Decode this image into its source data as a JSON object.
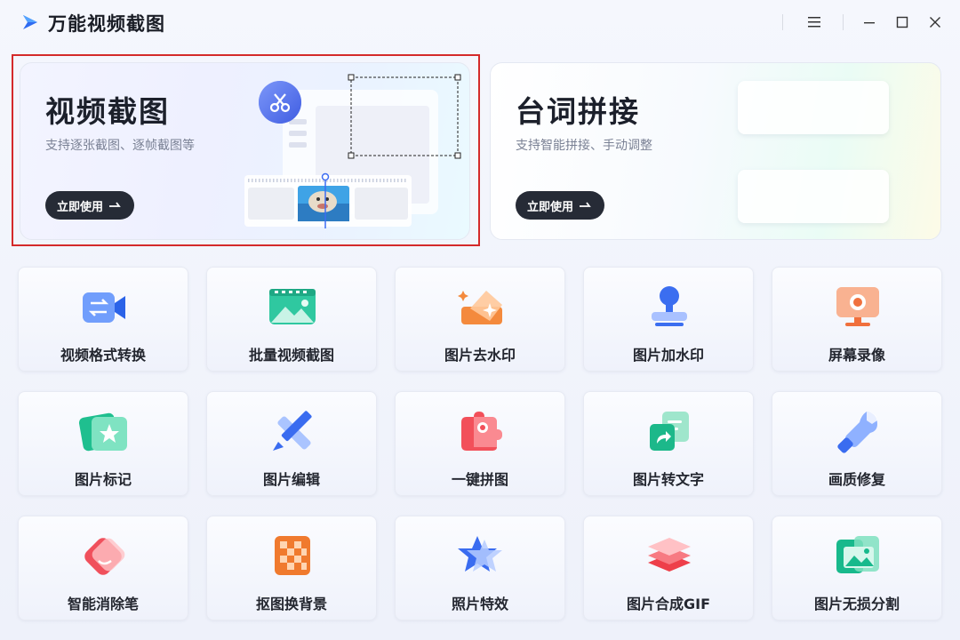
{
  "app": {
    "title": "万能视频截图"
  },
  "window_controls": [
    "menu-icon",
    "minimize-icon",
    "maximize-icon",
    "close-icon"
  ],
  "features": [
    {
      "title": "视频截图",
      "desc": "支持逐张截图、逐帧截图等",
      "button": "立即使用"
    },
    {
      "title": "台词拼接",
      "desc": "支持智能拼接、手动调整",
      "button": "立即使用"
    }
  ],
  "tools": [
    {
      "label": "视频格式转换",
      "icon": "video-convert-icon"
    },
    {
      "label": "批量视频截图",
      "icon": "batch-screenshot-icon"
    },
    {
      "label": "图片去水印",
      "icon": "remove-watermark-icon"
    },
    {
      "label": "图片加水印",
      "icon": "add-watermark-icon"
    },
    {
      "label": "屏幕录像",
      "icon": "screen-record-icon"
    },
    {
      "label": "图片标记",
      "icon": "image-mark-icon"
    },
    {
      "label": "图片编辑",
      "icon": "image-edit-icon"
    },
    {
      "label": "一键拼图",
      "icon": "puzzle-icon"
    },
    {
      "label": "图片转文字",
      "icon": "image-to-text-icon"
    },
    {
      "label": "画质修复",
      "icon": "quality-repair-icon"
    },
    {
      "label": "智能消除笔",
      "icon": "eraser-pen-icon"
    },
    {
      "label": "抠图换背景",
      "icon": "cutout-background-icon"
    },
    {
      "label": "照片特效",
      "icon": "photo-effect-icon"
    },
    {
      "label": "图片合成GIF",
      "icon": "gif-compose-icon"
    },
    {
      "label": "图片无损分割",
      "icon": "image-split-icon"
    }
  ],
  "colors": {
    "accent": "#3d6df2",
    "highlight": "#d42a2a",
    "button": "#262b36"
  }
}
